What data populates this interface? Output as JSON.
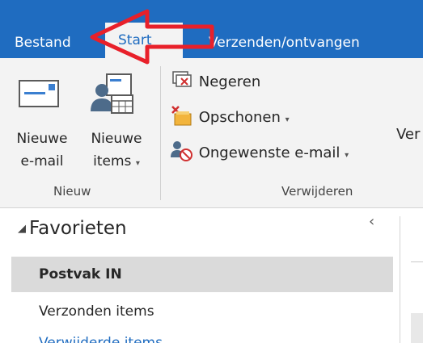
{
  "tabs": {
    "file": "Bestand",
    "start": "Start",
    "send_receive": "Verzenden/ontvangen"
  },
  "ribbon": {
    "new_email": {
      "line1": "Nieuwe",
      "line2": "e-mail"
    },
    "new_items": {
      "line1": "Nieuwe",
      "line2": "items"
    },
    "group_new": "Nieuw",
    "ignore": "Negeren",
    "clean_up": "Opschonen",
    "junk": "Ongewenste e-mail",
    "group_delete": "Verwijderen",
    "partial_next": "Ver"
  },
  "pane": {
    "favorites": "Favorieten",
    "folders": [
      "Postvak IN",
      "Verzonden items",
      "Verwijderde items"
    ]
  },
  "colors": {
    "tab_bar": "#1f6cc0",
    "ribbon": "#f3f3f3",
    "selected_folder": "#dadada",
    "annotation_arrow": "#e8202a"
  },
  "icons": {
    "new_email": "envelope-icon",
    "new_items": "people-calendar-icon",
    "ignore": "ignore-conversation-icon",
    "clean_up": "cleanup-icon",
    "junk": "junk-mail-icon",
    "collapse": "chevron-left-icon"
  }
}
